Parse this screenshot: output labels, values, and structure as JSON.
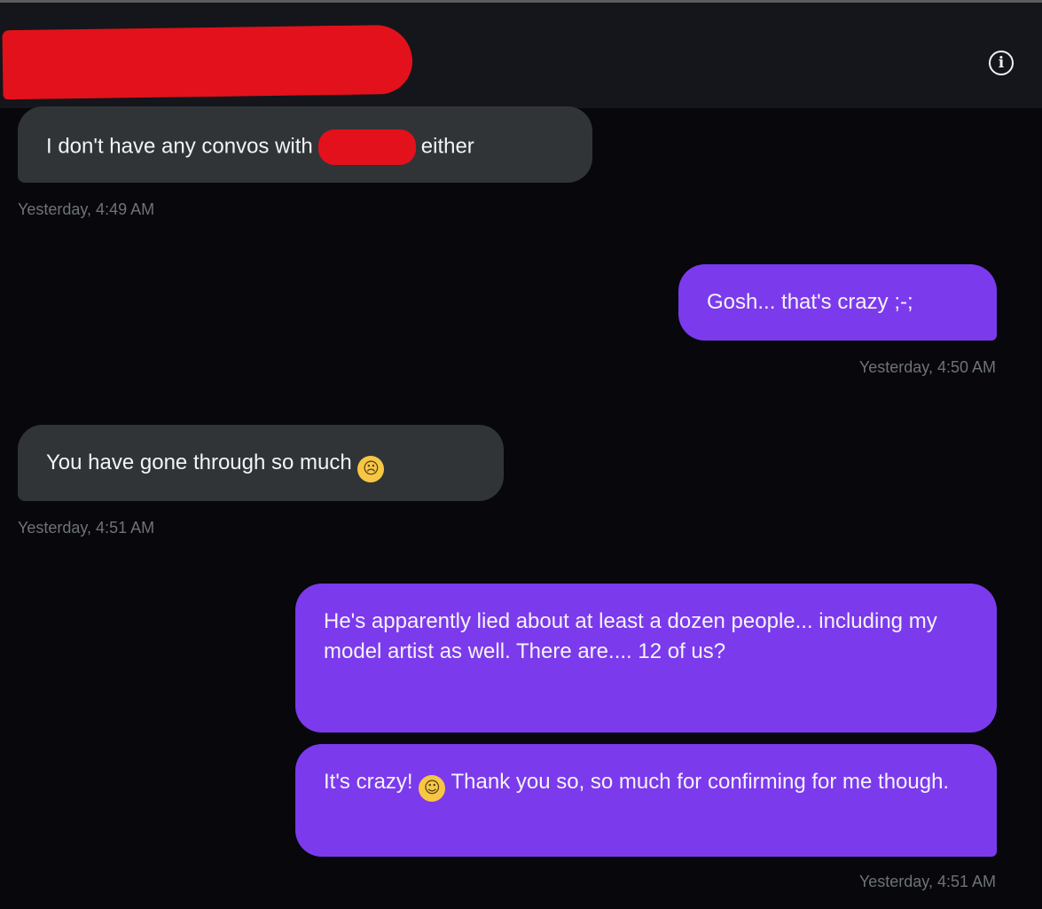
{
  "header": {
    "info_icon": "info-icon",
    "info_glyph": "i"
  },
  "messages": [
    {
      "id": "m1",
      "direction": "received",
      "text_before": "I don't have any convos with",
      "text_after": "either",
      "timestamp": "Yesterday, 4:49 AM"
    },
    {
      "id": "m2",
      "direction": "sent",
      "text": "Gosh... that's crazy ;-;",
      "timestamp": "Yesterday, 4:50 AM"
    },
    {
      "id": "m3",
      "direction": "received",
      "text": "You have gone through so much",
      "emoji": "loudly-crying-face",
      "timestamp": "Yesterday, 4:51 AM"
    },
    {
      "id": "m4",
      "direction": "sent",
      "text": "He's apparently lied about at least a dozen people... including my model artist as well. There are.... 12 of us?"
    },
    {
      "id": "m5",
      "direction": "sent",
      "text_before": "It's crazy!",
      "emoji": "face-holding-back-tears",
      "text_after": "Thank you so, so much for confirming for me though.",
      "timestamp": "Yesterday, 4:51 AM"
    }
  ],
  "colors": {
    "background": "#07070c",
    "header": "#14161b",
    "received_bubble": "#303437",
    "sent_bubble": "#7c3aed",
    "redaction": "#e3111b",
    "timestamp": "#6e7378"
  }
}
